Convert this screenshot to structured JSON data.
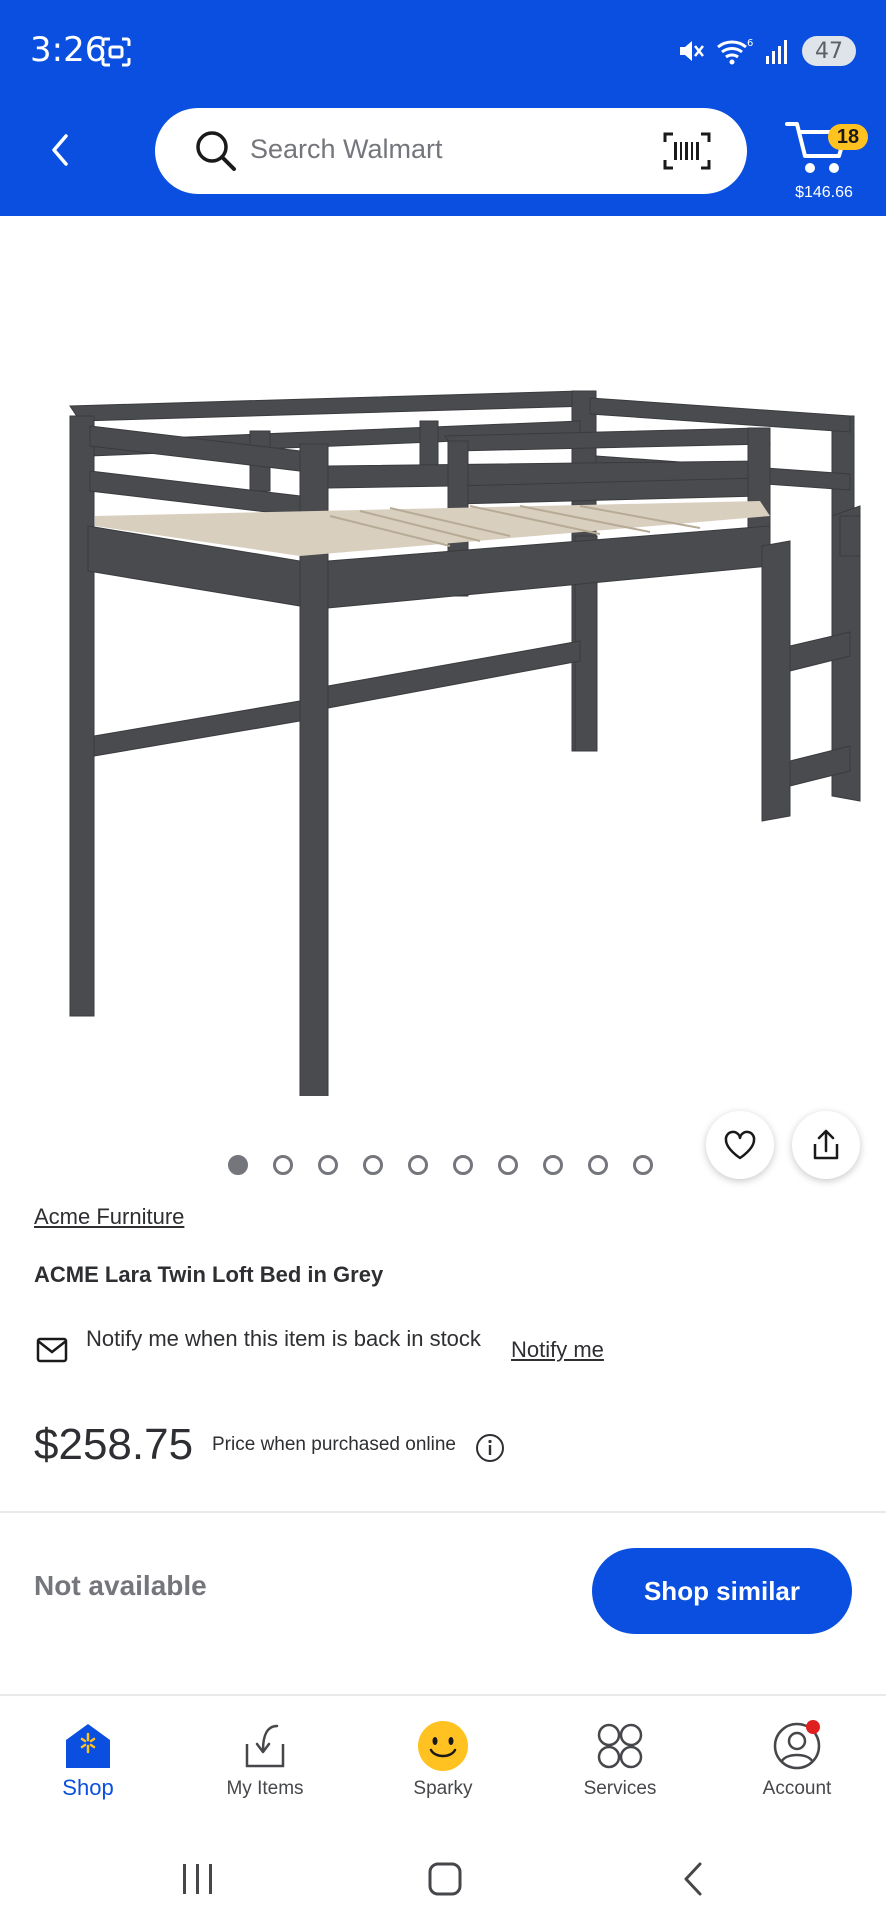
{
  "status_bar": {
    "time": "3:26",
    "battery": "47",
    "signal_label": "6"
  },
  "header": {
    "search_placeholder": "Search Walmart",
    "cart_count": "18",
    "cart_total": "$146.66"
  },
  "carousel": {
    "total": 10,
    "active_index": 0
  },
  "product": {
    "brand": "Acme Furniture",
    "title": "ACME Lara Twin Loft Bed in Grey",
    "notify_text": "Notify me when this item is back in stock",
    "notify_link": "Notify me",
    "price": "$258.75",
    "price_note": "Price when purchased online",
    "availability": "Not available",
    "action_label": "Shop similar"
  },
  "bottom_nav": {
    "items": [
      {
        "label": "Shop",
        "icon": "shop-icon",
        "active": true
      },
      {
        "label": "My Items",
        "icon": "my-items-icon",
        "active": false
      },
      {
        "label": "Sparky",
        "icon": "sparky-icon",
        "active": false
      },
      {
        "label": "Services",
        "icon": "services-icon",
        "active": false
      },
      {
        "label": "Account",
        "icon": "account-icon",
        "active": false
      }
    ]
  },
  "colors": {
    "brand_blue": "#0a4fe0",
    "badge_yellow": "#ffc220",
    "notification_red": "#e0201f"
  }
}
